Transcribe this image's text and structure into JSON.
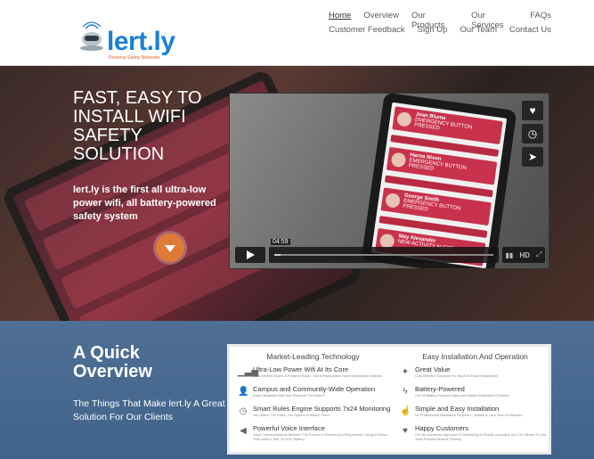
{
  "header": {
    "logo_text": "lert.ly",
    "logo_tagline": "Personal Safety Networks",
    "nav_row1": [
      "Home",
      "Overview",
      "Our Products",
      "Our Services",
      "FAQs"
    ],
    "nav_row2": [
      "Customer Feedback",
      "Sign Up",
      "Our Team",
      "Contact Us"
    ]
  },
  "hero": {
    "title": "FAST, EASY TO INSTALL WIFI SAFETY SOLUTION",
    "text": "lert.ly is the first all ultra-low power wifi, all battery-powered safety system",
    "video": {
      "time": "04:59",
      "progress": 0.03,
      "side_buttons": [
        "heart-icon",
        "clock-icon",
        "send-icon"
      ],
      "tools": "HD",
      "screen_names": [
        "Joan Blume",
        "Harna Nixon",
        "George Smith",
        "May Alexander"
      ],
      "screen_status": [
        "EMERGENCY BUTTON PRESSED",
        "EMERGENCY BUTTON PRESSED",
        "EMERGENCY BUTTON PRESSED",
        "NEW ACTIVITY ALERT"
      ]
    }
  },
  "overview": {
    "title": "A Quick Overview",
    "subtitle": "The Things That Make lert.ly A Great Solution For Our Clients",
    "left_head": "Market-Leading Technology",
    "right_head": "Easy Installation And Operation",
    "left_items": [
      {
        "icon": "signal-icon",
        "title": "Ultra-Low Power Wifi At Its Core",
        "desc": "Each Device Utilizes A Powerful Radio - Not A Repurposed Home Automation Network"
      },
      {
        "icon": "user-icon",
        "title": "Campus and Community-Wide Operation",
        "desc": "Easy Installation And Use Wherever You Need It"
      },
      {
        "icon": "clock-icon",
        "title": "Smart Rules Engine Supports 7x24 Monitoring",
        "desc": "You Define The Rules, Our System Enforces Them"
      },
      {
        "icon": "speaker-icon",
        "title": "Powerful Voice Interface",
        "desc": "Voice Communications Between The Person In Distress And Responders, Using A Device That Lasts A Year On A 9V Battery"
      }
    ],
    "right_items": [
      {
        "icon": "magic-icon",
        "title": "Great Value",
        "desc": "Cost Effective Solutions For Big And Small Installations"
      },
      {
        "icon": "bolt-icon",
        "title": "Battery-Powered",
        "desc": "Our All Battery Powered Approach Makes Installation A Breeze"
      },
      {
        "icon": "thumbs-up-icon",
        "title": "Simple and Easy Installation",
        "desc": "No Professional Installation Required - Installs In Less Than 20 Minutes"
      },
      {
        "icon": "heart-icon",
        "title": "Happy Customers",
        "desc": "Our No-Nonsense Approach To Monitoring Is Readily Accepted, And Our Simple To Use Tools Require Minimal Training"
      }
    ]
  }
}
